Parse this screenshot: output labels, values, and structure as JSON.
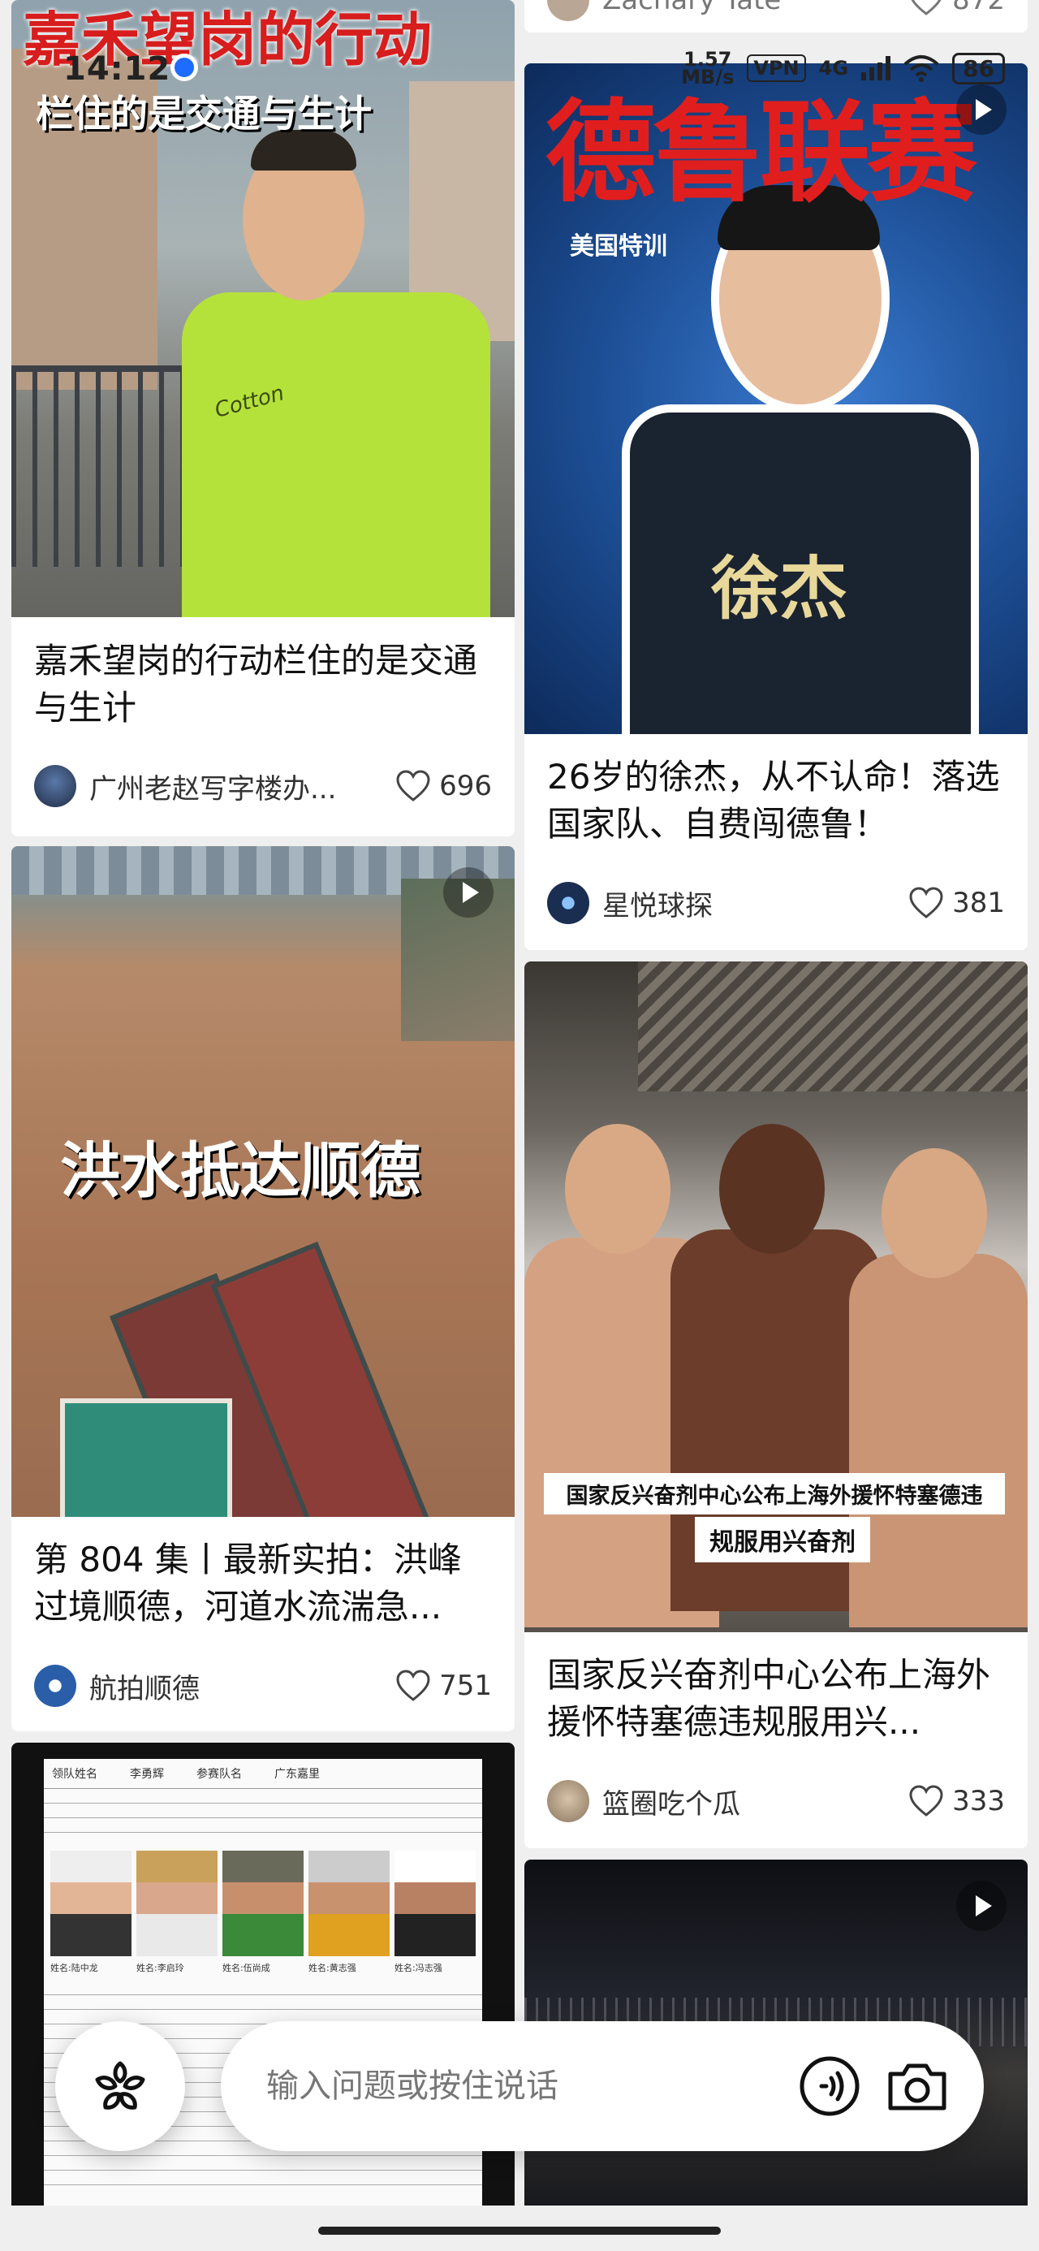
{
  "status_bar": {
    "time": "14:12",
    "net_speed_value": "1.57",
    "net_speed_unit": "MB/s",
    "vpn": "VPN",
    "network": "4G",
    "battery": "86"
  },
  "left_column": [
    {
      "overlay_line1": "嘉禾望岗的行动",
      "overlay_line2": "栏住的是交通与生计",
      "title": "嘉禾望岗的行动栏住的是交通与生计",
      "author": "广州老赵写字楼办...",
      "likes": "696",
      "shirt_text": "Cotton"
    },
    {
      "overlay": "洪水抵达顺德",
      "title": "第 804 集丨最新实拍：洪峰过境顺德，河道水流湍急...",
      "author": "航拍顺德",
      "likes": "751",
      "has_video": true
    },
    {
      "doc_header": [
        "领队姓名",
        "李勇辉",
        "参赛队名",
        "广东嘉里"
      ],
      "player_labels": [
        "姓名:陆中龙",
        "姓名:李启玲",
        "姓名:伍尚成",
        "姓名:黄志强",
        "姓名:冯志强"
      ]
    }
  ],
  "right_column": [
    {
      "author_partial": "Zachary Tate",
      "likes": "872"
    },
    {
      "overlay_big": "德鲁联赛",
      "overlay_small": "美国特训",
      "jersey_name": "徐杰",
      "title": "26岁的徐杰，从不认命！落选国家队、自费闯德鲁！",
      "author": "星悦球探",
      "likes": "381",
      "has_video": true
    },
    {
      "caption_line1": "国家反兴奋剂中心公布上海外援怀特塞德违",
      "caption_line2": "规服用兴奋剂",
      "title": "国家反兴奋剂中心公布上海外援怀特塞德违规服用兴...",
      "author": "篮圈吃个瓜",
      "likes": "333"
    },
    {
      "has_video": true
    }
  ],
  "assistant_bar": {
    "placeholder": "输入问题或按住说话"
  },
  "colors": {
    "accent_red": "#d71d1d",
    "background": "#efefef"
  },
  "icons": [
    "location-icon",
    "signal-icon",
    "wifi-icon",
    "heart-icon",
    "play-icon",
    "ai-flower-icon",
    "voice-icon",
    "camera-icon"
  ]
}
